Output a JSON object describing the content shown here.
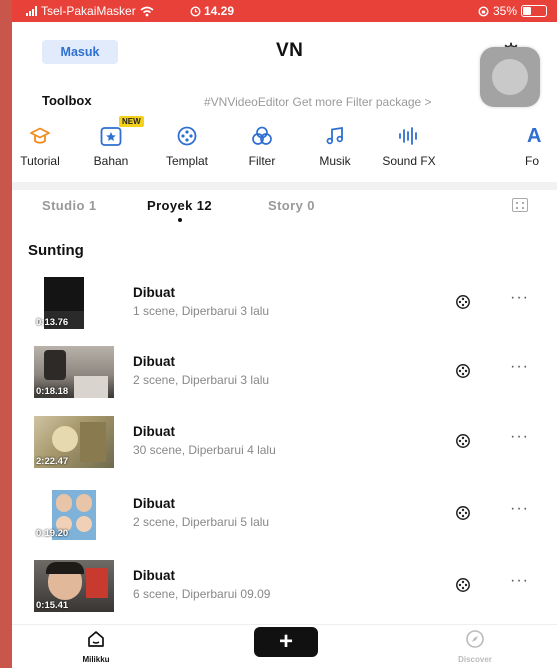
{
  "status_bar": {
    "carrier": "Tsel-PakaiMasker",
    "time": "14.29",
    "battery": "35%"
  },
  "header": {
    "login_label": "Masuk",
    "title": "VN"
  },
  "toolbox": {
    "label": "Toolbox",
    "promo": "#VNVideoEditor Get more Filter package >",
    "items": [
      {
        "label": "Tutorial",
        "icon": "graduation-cap-icon"
      },
      {
        "label": "Bahan",
        "icon": "star-icon",
        "badge": "NEW"
      },
      {
        "label": "Templat",
        "icon": "film-reel-icon"
      },
      {
        "label": "Filter",
        "icon": "filter-circles-icon"
      },
      {
        "label": "Musik",
        "icon": "music-note-icon"
      },
      {
        "label": "Sound FX",
        "icon": "waveform-icon"
      },
      {
        "label": "Fo",
        "icon": "font-icon",
        "glyph": "A"
      }
    ]
  },
  "tabs": [
    {
      "label": "Studio 1",
      "active": false
    },
    {
      "label": "Proyek 12",
      "active": true
    },
    {
      "label": "Story 0",
      "active": false
    }
  ],
  "section_title": "Sunting",
  "projects": [
    {
      "title": "Dibuat",
      "subtitle": "1 scene, Diperbarui 3 lalu",
      "duration": "0:13.76"
    },
    {
      "title": "Dibuat",
      "subtitle": "2 scene, Diperbarui 3 lalu",
      "duration": "0:18.18"
    },
    {
      "title": "Dibuat",
      "subtitle": "30 scene, Diperbarui 4 lalu",
      "duration": "2:22.47"
    },
    {
      "title": "Dibuat",
      "subtitle": "2 scene, Diperbarui 5 lalu",
      "duration": "0:19.20"
    },
    {
      "title": "Dibuat",
      "subtitle": "6 scene, Diperbarui 09.09",
      "duration": "0:15.41"
    }
  ],
  "more_label": "···",
  "bottom_nav": {
    "home_label": "Milikku",
    "add_label": "+",
    "discover_label": "Discover"
  },
  "colors": {
    "status_bar": "#e8413a",
    "accent_blue": "#2f6fd1",
    "badge_yellow": "#f4d21c"
  }
}
